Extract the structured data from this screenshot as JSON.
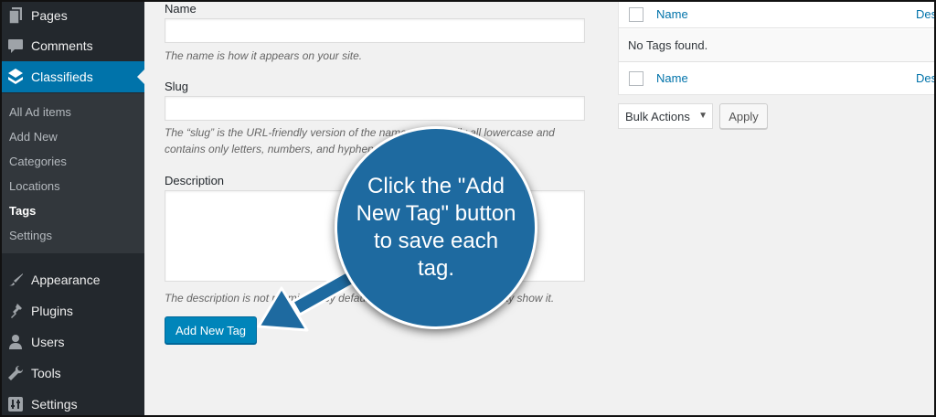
{
  "sidebar": {
    "menu": [
      {
        "label": "Pages",
        "icon": "pages-icon"
      },
      {
        "label": "Comments",
        "icon": "comments-icon"
      },
      {
        "label": "Classifieds",
        "icon": "classifieds-icon"
      },
      {
        "label": "Appearance",
        "icon": "appearance-icon"
      },
      {
        "label": "Plugins",
        "icon": "plugins-icon"
      },
      {
        "label": "Users",
        "icon": "users-icon"
      },
      {
        "label": "Tools",
        "icon": "tools-icon"
      },
      {
        "label": "Settings",
        "icon": "settings-icon"
      }
    ],
    "submenu": [
      "All Ad items",
      "Add New",
      "Categories",
      "Locations",
      "Tags",
      "Settings"
    ],
    "current_submenu": "Tags"
  },
  "form": {
    "name_label": "Name",
    "name_value": "",
    "name_help": "The name is how it appears on your site.",
    "slug_label": "Slug",
    "slug_value": "",
    "slug_help_line1": "The “slug” is the URL-friendly version of the name. It is usually all lowercase and",
    "slug_help_line2": "contains only letters, numbers, and hyphens.",
    "description_label": "Description",
    "description_value": "",
    "description_help": "The description is not prominent by default; however, some themes may show it.",
    "submit_label": "Add New Tag"
  },
  "table": {
    "header_name": "Name",
    "header_desc": "Description",
    "empty_message": "No Tags found.",
    "footer_name": "Name",
    "footer_desc": "Description"
  },
  "bulk": {
    "select_value": "Bulk Actions",
    "apply_label": "Apply"
  },
  "callout": {
    "text": "Click the \"Add New Tag\" button to save each tag."
  },
  "colors": {
    "sidebar_bg": "#23282d",
    "accent": "#0073aa",
    "primary_button": "#0085ba",
    "callout_bg": "#1e6aa0"
  }
}
